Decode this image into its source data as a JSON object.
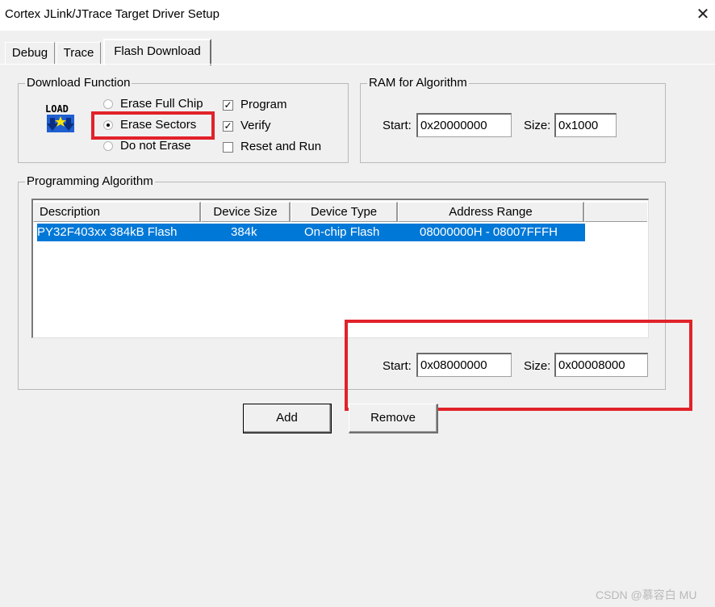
{
  "window": {
    "title": "Cortex JLink/JTrace Target Driver Setup",
    "close_glyph": "✕"
  },
  "tabs": [
    {
      "label": "Debug",
      "active": false
    },
    {
      "label": "Trace",
      "active": false
    },
    {
      "label": "Flash Download",
      "active": true
    }
  ],
  "download_function": {
    "label": "Download Function",
    "icon_text": "LOAD",
    "options": [
      {
        "label": "Erase Full Chip",
        "checked": false
      },
      {
        "label": "Erase Sectors",
        "checked": true
      },
      {
        "label": "Do not Erase",
        "checked": false
      }
    ],
    "checks": [
      {
        "label": "Program",
        "checked": true,
        "mark": "✓"
      },
      {
        "label": "Verify",
        "checked": true,
        "mark": "✓"
      },
      {
        "label": "Reset and Run",
        "checked": false,
        "mark": ""
      }
    ]
  },
  "ram": {
    "label": "RAM for Algorithm",
    "start_label": "Start:",
    "start_value": "0x20000000",
    "size_label": "Size:",
    "size_value": "0x1000"
  },
  "programming": {
    "label": "Programming Algorithm",
    "columns": [
      "Description",
      "Device Size",
      "Device Type",
      "Address Range"
    ],
    "rows": [
      {
        "description": "PY32F403xx 384kB Flash",
        "size": "384k",
        "type": "On-chip Flash",
        "range": "08000000H - 08007FFFH",
        "selected": true
      }
    ],
    "start_label": "Start:",
    "start_value": "0x08000000",
    "size_label": "Size:",
    "size_value": "0x00008000"
  },
  "buttons": {
    "add": "Add",
    "remove": "Remove"
  },
  "highlight_color": "#e1222a",
  "selection_color": "#0078d7",
  "watermark": "CSDN @慕容白 MU"
}
